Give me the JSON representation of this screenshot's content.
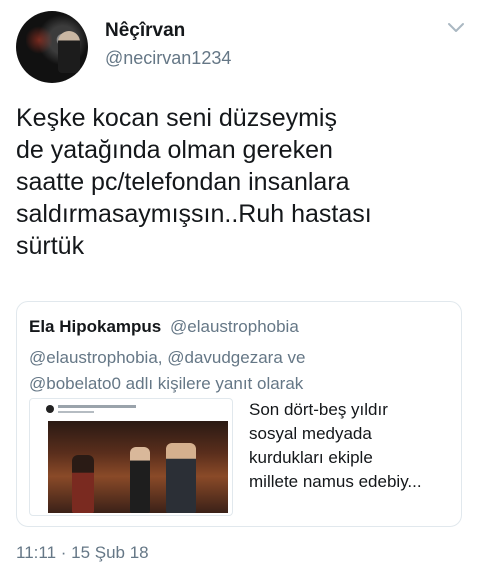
{
  "author": {
    "display_name": "Nêçîrvan",
    "handle": "@necirvan1234",
    "avatar_icon": "profile-photo-avatar"
  },
  "tweet": {
    "text": "Keşke kocan seni düzseymiş\nde yatağında olman gereken\nsaatte pc/telefondan insanlara\nsaldırmasaymışsın..Ruh hastası\nsürtük",
    "timestamp": "11:11 · 15 Şub 18"
  },
  "quoted_tweet": {
    "display_name": "Ela Hipokampus",
    "handle": "@elaustrophobia",
    "reply_context": "@elaustrophobia, @davudgezara ve\n@bobelato0 adlı kişilere yanıt olarak",
    "text": "Son dört-beş yıldır\nsosyal medyada\nkurdukları ekiple\nmillete namus edebiy..."
  },
  "colors": {
    "text_primary": "#14171a",
    "text_secondary": "#657786",
    "border": "#e1e8ed"
  }
}
